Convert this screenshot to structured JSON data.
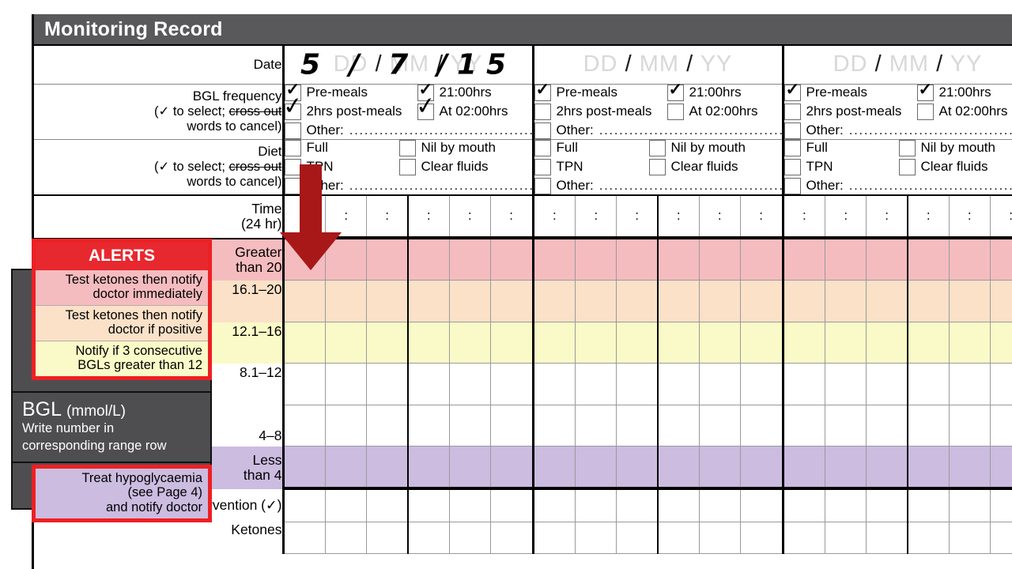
{
  "header": {
    "title": "Monitoring Record"
  },
  "labels": {
    "date": "Date",
    "bgl_frequency": "BGL frequency",
    "diet": "Diet",
    "select_hint_prefix": "(✓ to select; ",
    "select_hint_strike": "cross out",
    "select_hint_suffix": "words to cancel)",
    "time": "Time",
    "time_unit": "(24 hr)",
    "hypo_intervention": "Hypoglycaemia intervention (✓)",
    "ketones": "Ketones"
  },
  "date_placeholder": {
    "dd": "DD",
    "mm": "MM",
    "yy": "YY",
    "sep": "/"
  },
  "columns": [
    {
      "date_written": "5 / 7 /15",
      "has_handwriting": true,
      "bgl_frequency": [
        {
          "label": "Pre-meals",
          "checked": true,
          "hand_checked": false
        },
        {
          "label": "21:00hrs",
          "checked": true,
          "hand_checked": false
        },
        {
          "label": "2hrs post-meals",
          "checked": false,
          "hand_checked": true
        },
        {
          "label": "At 02:00hrs",
          "checked": false,
          "hand_checked": true
        },
        {
          "label": "Other:",
          "checked": false,
          "hand_checked": false
        }
      ],
      "diet": [
        {
          "label": "Full",
          "checked": false
        },
        {
          "label": "Nil by mouth",
          "checked": false
        },
        {
          "label": "TPN",
          "checked": false
        },
        {
          "label": "Clear fluids",
          "checked": false
        },
        {
          "label": "Other:",
          "checked": false
        }
      ]
    },
    {
      "date_written": "",
      "has_handwriting": false,
      "bgl_frequency": [
        {
          "label": "Pre-meals",
          "checked": true,
          "hand_checked": false
        },
        {
          "label": "21:00hrs",
          "checked": true,
          "hand_checked": false
        },
        {
          "label": "2hrs post-meals",
          "checked": false,
          "hand_checked": false
        },
        {
          "label": "At 02:00hrs",
          "checked": false,
          "hand_checked": false
        },
        {
          "label": "Other:",
          "checked": false,
          "hand_checked": false
        }
      ],
      "diet": [
        {
          "label": "Full",
          "checked": false
        },
        {
          "label": "Nil by mouth",
          "checked": false
        },
        {
          "label": "TPN",
          "checked": false
        },
        {
          "label": "Clear fluids",
          "checked": false
        },
        {
          "label": "Other:",
          "checked": false
        }
      ]
    },
    {
      "date_written": "",
      "has_handwriting": false,
      "bgl_frequency": [
        {
          "label": "Pre-meals",
          "checked": true,
          "hand_checked": false
        },
        {
          "label": "21:00hrs",
          "checked": true,
          "hand_checked": false
        },
        {
          "label": "2hrs post-meals",
          "checked": false,
          "hand_checked": false
        },
        {
          "label": "At 02:00hrs",
          "checked": false,
          "hand_checked": false
        },
        {
          "label": "Other:",
          "checked": false,
          "hand_checked": false
        }
      ],
      "diet": [
        {
          "label": "Full",
          "checked": false
        },
        {
          "label": "Nil by mouth",
          "checked": false
        },
        {
          "label": "TPN",
          "checked": false
        },
        {
          "label": "Clear fluids",
          "checked": false
        },
        {
          "label": "Other:",
          "checked": false
        }
      ]
    }
  ],
  "time_separator": ":",
  "bgl_ranges": [
    {
      "line1": "Greater",
      "line2": "than 20",
      "tint": "r-pink"
    },
    {
      "line1": "16.1–20",
      "line2": "",
      "tint": "r-peach"
    },
    {
      "line1": "12.1–16",
      "line2": "",
      "tint": "r-yellow"
    },
    {
      "line1": "8.1–12",
      "line2": "",
      "tint": "r-white"
    },
    {
      "line1": "4–8",
      "line2": "",
      "tint": "r-white"
    },
    {
      "line1": "Less",
      "line2": "than 4",
      "tint": "r-lav"
    }
  ],
  "alerts": {
    "title": "ALERTS",
    "items": [
      {
        "line1": "Test ketones then notify",
        "line2": "doctor immediately",
        "tint": "a-pink"
      },
      {
        "line1": "Test ketones then notify",
        "line2": "doctor if positive",
        "tint": "a-peach"
      },
      {
        "line1": "Notify if 3 consecutive",
        "line2": "BGLs greater than 12",
        "tint": "a-yellow"
      }
    ]
  },
  "bgl_note": {
    "title": "BGL",
    "unit": "(mmol/L)",
    "line1": "Write number in",
    "line2": "corresponding range row"
  },
  "hypo_box": {
    "line1": "Treat hypoglycaemia",
    "line2": "(see Page 4)",
    "line3": "and notify doctor"
  },
  "annotation": {
    "arrow": "down-arrow",
    "color": "#a81818"
  },
  "colors": {
    "header_bar": "#59595c",
    "alert_red": "#ed2024",
    "pink": "#f5bcbf",
    "peach": "#fae1c8",
    "yellow": "#fafac8",
    "lavender": "#cbbce0",
    "dark_panel": "#4e4e51"
  }
}
